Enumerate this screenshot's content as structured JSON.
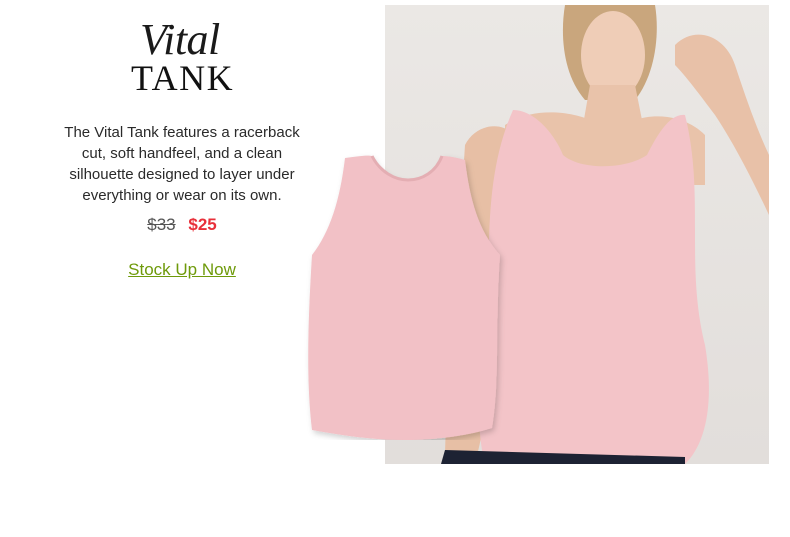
{
  "title": {
    "script": "Vital",
    "main": "TANK"
  },
  "description": "The Vital Tank features a racerback cut, soft handfeel, and a clean silhouette designed to layer under everything or wear on its own.",
  "price": {
    "original": "$33",
    "sale": "$25"
  },
  "cta": {
    "label": "Stock Up Now"
  },
  "colors": {
    "sale": "#e8303a",
    "cta": "#6e9a0a",
    "product": "#f3c4c8"
  }
}
